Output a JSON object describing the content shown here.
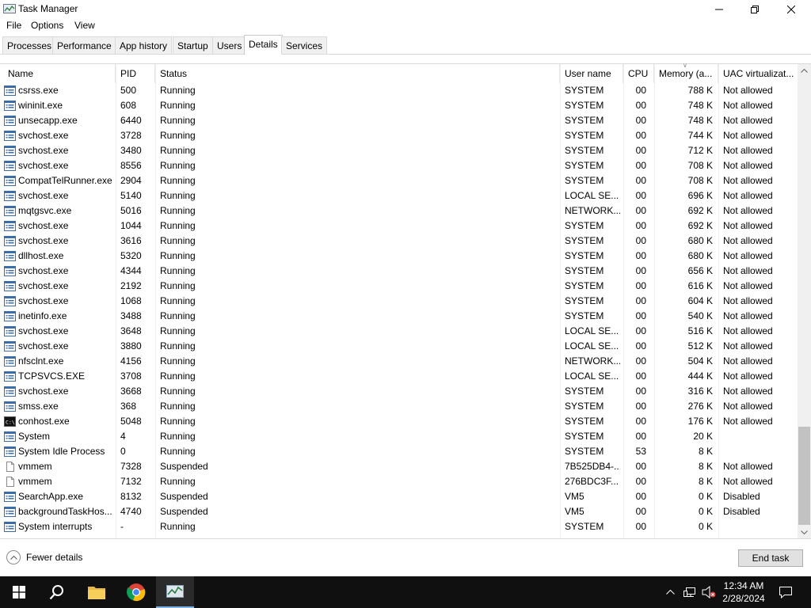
{
  "window": {
    "title": "Task Manager",
    "icon": "task-manager-icon",
    "controls": {
      "minimize": "minimize-icon",
      "maximize": "restore-icon",
      "close": "close-icon"
    }
  },
  "menu": [
    "File",
    "Options",
    "View"
  ],
  "tabs": [
    "Processes",
    "Performance",
    "App history",
    "Startup",
    "Users",
    "Details",
    "Services"
  ],
  "active_tab": "Details",
  "columns": [
    "Name",
    "PID",
    "Status",
    "User name",
    "CPU",
    "Memory (a...",
    "UAC virtualizat..."
  ],
  "rows": [
    {
      "icon": "process-icon",
      "name": "csrss.exe",
      "pid": "500",
      "status": "Running",
      "user": "SYSTEM",
      "cpu": "00",
      "mem": "788 K",
      "uac": "Not allowed"
    },
    {
      "icon": "process-icon",
      "name": "wininit.exe",
      "pid": "608",
      "status": "Running",
      "user": "SYSTEM",
      "cpu": "00",
      "mem": "748 K",
      "uac": "Not allowed"
    },
    {
      "icon": "process-icon",
      "name": "unsecapp.exe",
      "pid": "6440",
      "status": "Running",
      "user": "SYSTEM",
      "cpu": "00",
      "mem": "748 K",
      "uac": "Not allowed"
    },
    {
      "icon": "process-icon",
      "name": "svchost.exe",
      "pid": "3728",
      "status": "Running",
      "user": "SYSTEM",
      "cpu": "00",
      "mem": "744 K",
      "uac": "Not allowed"
    },
    {
      "icon": "process-icon",
      "name": "svchost.exe",
      "pid": "3480",
      "status": "Running",
      "user": "SYSTEM",
      "cpu": "00",
      "mem": "712 K",
      "uac": "Not allowed"
    },
    {
      "icon": "process-icon",
      "name": "svchost.exe",
      "pid": "8556",
      "status": "Running",
      "user": "SYSTEM",
      "cpu": "00",
      "mem": "708 K",
      "uac": "Not allowed"
    },
    {
      "icon": "process-icon",
      "name": "CompatTelRunner.exe",
      "pid": "2904",
      "status": "Running",
      "user": "SYSTEM",
      "cpu": "00",
      "mem": "708 K",
      "uac": "Not allowed"
    },
    {
      "icon": "process-icon",
      "name": "svchost.exe",
      "pid": "5140",
      "status": "Running",
      "user": "LOCAL SE...",
      "cpu": "00",
      "mem": "696 K",
      "uac": "Not allowed"
    },
    {
      "icon": "process-icon",
      "name": "mqtgsvc.exe",
      "pid": "5016",
      "status": "Running",
      "user": "NETWORK...",
      "cpu": "00",
      "mem": "692 K",
      "uac": "Not allowed"
    },
    {
      "icon": "process-icon",
      "name": "svchost.exe",
      "pid": "1044",
      "status": "Running",
      "user": "SYSTEM",
      "cpu": "00",
      "mem": "692 K",
      "uac": "Not allowed"
    },
    {
      "icon": "process-icon",
      "name": "svchost.exe",
      "pid": "3616",
      "status": "Running",
      "user": "SYSTEM",
      "cpu": "00",
      "mem": "680 K",
      "uac": "Not allowed"
    },
    {
      "icon": "process-icon",
      "name": "dllhost.exe",
      "pid": "5320",
      "status": "Running",
      "user": "SYSTEM",
      "cpu": "00",
      "mem": "680 K",
      "uac": "Not allowed"
    },
    {
      "icon": "process-icon",
      "name": "svchost.exe",
      "pid": "4344",
      "status": "Running",
      "user": "SYSTEM",
      "cpu": "00",
      "mem": "656 K",
      "uac": "Not allowed"
    },
    {
      "icon": "process-icon",
      "name": "svchost.exe",
      "pid": "2192",
      "status": "Running",
      "user": "SYSTEM",
      "cpu": "00",
      "mem": "616 K",
      "uac": "Not allowed"
    },
    {
      "icon": "process-icon",
      "name": "svchost.exe",
      "pid": "1068",
      "status": "Running",
      "user": "SYSTEM",
      "cpu": "00",
      "mem": "604 K",
      "uac": "Not allowed"
    },
    {
      "icon": "process-icon",
      "name": "inetinfo.exe",
      "pid": "3488",
      "status": "Running",
      "user": "SYSTEM",
      "cpu": "00",
      "mem": "540 K",
      "uac": "Not allowed"
    },
    {
      "icon": "process-icon",
      "name": "svchost.exe",
      "pid": "3648",
      "status": "Running",
      "user": "LOCAL SE...",
      "cpu": "00",
      "mem": "516 K",
      "uac": "Not allowed"
    },
    {
      "icon": "process-icon",
      "name": "svchost.exe",
      "pid": "3880",
      "status": "Running",
      "user": "LOCAL SE...",
      "cpu": "00",
      "mem": "512 K",
      "uac": "Not allowed"
    },
    {
      "icon": "process-icon",
      "name": "nfsclnt.exe",
      "pid": "4156",
      "status": "Running",
      "user": "NETWORK...",
      "cpu": "00",
      "mem": "504 K",
      "uac": "Not allowed"
    },
    {
      "icon": "process-icon",
      "name": "TCPSVCS.EXE",
      "pid": "3708",
      "status": "Running",
      "user": "LOCAL SE...",
      "cpu": "00",
      "mem": "444 K",
      "uac": "Not allowed"
    },
    {
      "icon": "process-icon",
      "name": "svchost.exe",
      "pid": "3668",
      "status": "Running",
      "user": "SYSTEM",
      "cpu": "00",
      "mem": "316 K",
      "uac": "Not allowed"
    },
    {
      "icon": "process-icon",
      "name": "smss.exe",
      "pid": "368",
      "status": "Running",
      "user": "SYSTEM",
      "cpu": "00",
      "mem": "276 K",
      "uac": "Not allowed"
    },
    {
      "icon": "console-icon",
      "name": "conhost.exe",
      "pid": "5048",
      "status": "Running",
      "user": "SYSTEM",
      "cpu": "00",
      "mem": "176 K",
      "uac": "Not allowed"
    },
    {
      "icon": "process-icon",
      "name": "System",
      "pid": "4",
      "status": "Running",
      "user": "SYSTEM",
      "cpu": "00",
      "mem": "20 K",
      "uac": ""
    },
    {
      "icon": "process-icon",
      "name": "System Idle Process",
      "pid": "0",
      "status": "Running",
      "user": "SYSTEM",
      "cpu": "53",
      "mem": "8 K",
      "uac": ""
    },
    {
      "icon": "blank-file-icon",
      "name": "vmmem",
      "pid": "7328",
      "status": "Suspended",
      "user": "7B525DB4-...",
      "cpu": "00",
      "mem": "8 K",
      "uac": "Not allowed"
    },
    {
      "icon": "blank-file-icon",
      "name": "vmmem",
      "pid": "7132",
      "status": "Running",
      "user": "276BDC3F...",
      "cpu": "00",
      "mem": "8 K",
      "uac": "Not allowed"
    },
    {
      "icon": "process-icon",
      "name": "SearchApp.exe",
      "pid": "8132",
      "status": "Suspended",
      "user": "VM5",
      "cpu": "00",
      "mem": "0 K",
      "uac": "Disabled"
    },
    {
      "icon": "process-icon",
      "name": "backgroundTaskHos...",
      "pid": "4740",
      "status": "Suspended",
      "user": "VM5",
      "cpu": "00",
      "mem": "0 K",
      "uac": "Disabled"
    },
    {
      "icon": "process-icon",
      "name": "System interrupts",
      "pid": "-",
      "status": "Running",
      "user": "SYSTEM",
      "cpu": "00",
      "mem": "0 K",
      "uac": ""
    }
  ],
  "footer": {
    "fewer_details": "Fewer details",
    "end_task": "End task"
  },
  "taskbar": {
    "items": [
      "start-windows-icon",
      "search-icon",
      "file-explorer-icon",
      "chrome-icon",
      "task-manager-icon"
    ],
    "tray": [
      "chevron-up-icon",
      "network-icon",
      "volume-muted-icon"
    ],
    "time": "12:34 AM",
    "date": "2/28/2024",
    "notifications": "notification-icon"
  }
}
